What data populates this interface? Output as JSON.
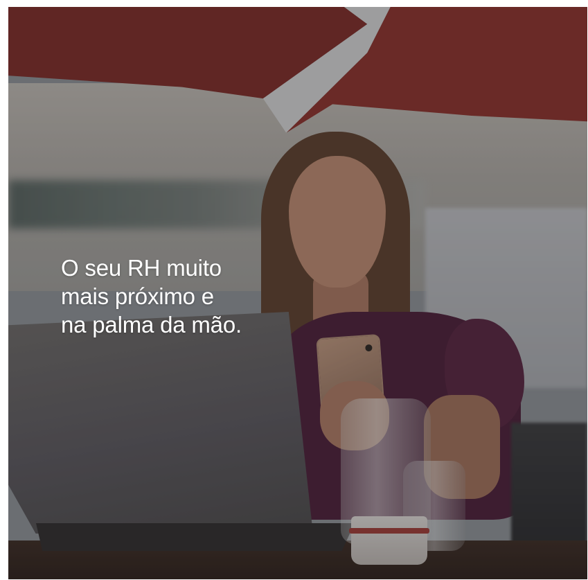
{
  "headline": {
    "lines": [
      "O seu RH muito",
      "mais próximo e",
      "na palma da mão."
    ]
  },
  "colors": {
    "text": "#ffffff",
    "awning": "#88302a",
    "dress": "#4a1e36"
  }
}
